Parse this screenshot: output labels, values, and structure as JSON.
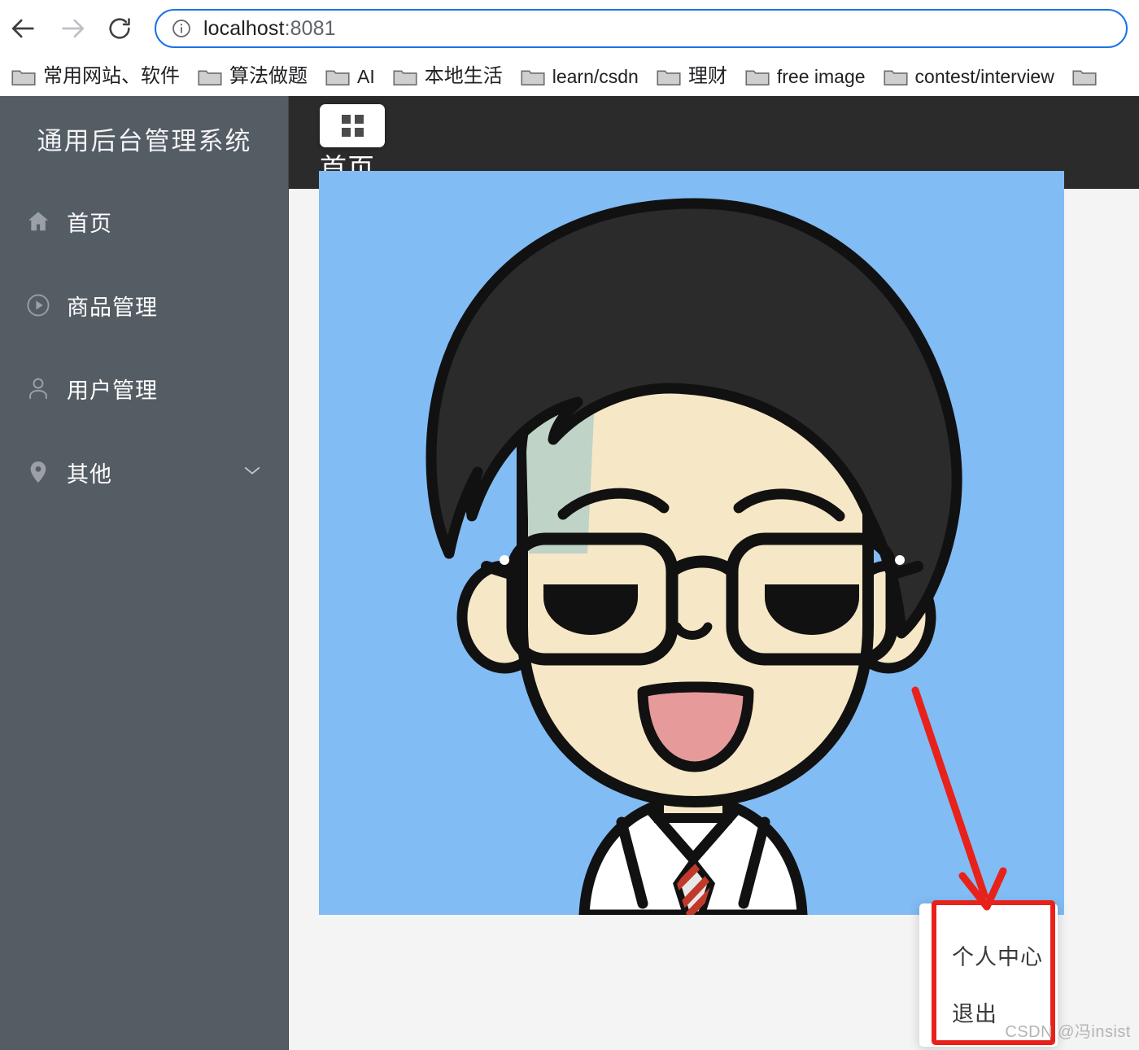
{
  "browser": {
    "nav": {
      "back_icon": "arrow-left-icon",
      "forward_icon": "arrow-right-icon",
      "reload_icon": "reload-icon"
    },
    "address_bar": {
      "info_icon": "info-circle-icon",
      "url_host": "localhost",
      "url_port": ":8081",
      "full_url": "localhost:8081"
    },
    "bookmarks": [
      {
        "label": "常用网站、软件",
        "icon": "folder-icon",
        "cjk": true
      },
      {
        "label": "算法做题",
        "icon": "folder-icon",
        "cjk": true
      },
      {
        "label": "AI",
        "icon": "folder-icon",
        "cjk": false
      },
      {
        "label": "本地生活",
        "icon": "folder-icon",
        "cjk": true
      },
      {
        "label": "learn/csdn",
        "icon": "folder-icon",
        "cjk": false
      },
      {
        "label": "理财",
        "icon": "folder-icon",
        "cjk": true
      },
      {
        "label": "free image",
        "icon": "folder-icon",
        "cjk": false
      },
      {
        "label": "contest/interview",
        "icon": "folder-icon",
        "cjk": false
      }
    ]
  },
  "sidebar": {
    "title": "通用后台管理系统",
    "background_color": "#545c64",
    "items": [
      {
        "label": "首页",
        "icon": "home-icon",
        "has_arrow": false
      },
      {
        "label": "商品管理",
        "icon": "play-circle-icon",
        "has_arrow": false
      },
      {
        "label": "用户管理",
        "icon": "user-icon",
        "has_arrow": false
      },
      {
        "label": "其他",
        "icon": "location-pin-icon",
        "has_arrow": true,
        "arrow_icon": "chevron-down-icon"
      }
    ]
  },
  "header": {
    "grid_toggle_icon": "grid-menu-icon",
    "breadcrumb": "首页",
    "background_color": "#2b2b2b"
  },
  "content": {
    "image_name": "user-avatar-cartoon",
    "image_background_color": "#82bcf4"
  },
  "dropdown": {
    "items": [
      {
        "label": "个人中心"
      },
      {
        "label": "退出"
      }
    ]
  },
  "annotations": {
    "arrow_color": "#e8211a",
    "rect_color": "#e8211a"
  },
  "watermark": {
    "text": "CSDN @冯insist"
  }
}
